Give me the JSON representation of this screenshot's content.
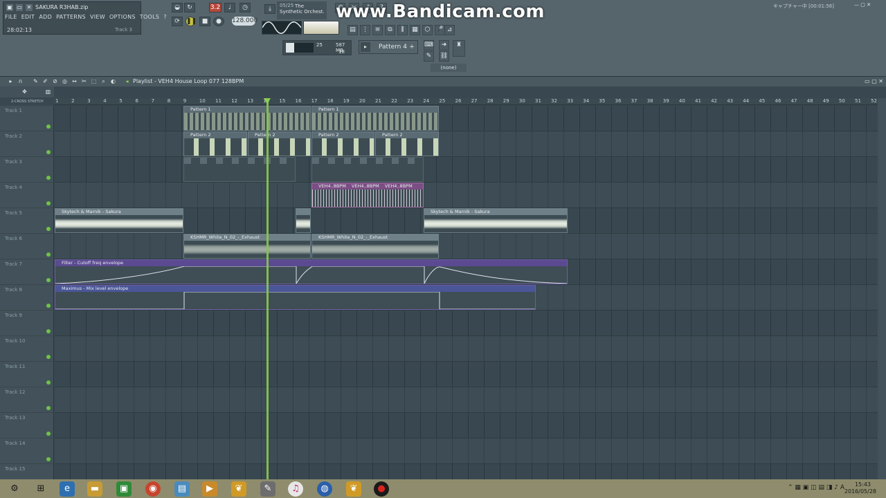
{
  "window": {
    "zip_name": "SAKURA R3HAB.zip",
    "time_readout": "28:02:13",
    "track_hint": "Track 3",
    "menu": [
      "FILE",
      "EDIT",
      "ADD",
      "PATTERNS",
      "VIEW",
      "OPTIONS",
      "TOOLS",
      "?"
    ]
  },
  "transport": {
    "record_label": "3.2",
    "tempo": "128.000"
  },
  "song_info": {
    "counter": "05/25",
    "title_line1": "The",
    "title_line2": "Synthetic Orchest."
  },
  "cpu": {
    "polyphony": "25",
    "memory": "587 MB",
    "voices": "18",
    "cpu_level_fraction": 0.3
  },
  "pattern_selector": {
    "label": "Pattern 4",
    "add": "+"
  },
  "snap": {
    "value": "(none)"
  },
  "watermark": "www.Bandicam.com",
  "capture": {
    "status": "キャプチャー中 [00:01:56]",
    "date": "2016/05/28"
  },
  "playlist": {
    "title": "Playlist - VEH4 House Loop 077 128BPM",
    "snap_labels": "2-CROSS STRETCH",
    "ruler": [
      "1",
      "2",
      "3",
      "4",
      "5",
      "6",
      "7",
      "8",
      "9",
      "10",
      "11",
      "12",
      "13",
      "14",
      "15",
      "16",
      "17",
      "18",
      "19",
      "20",
      "21",
      "22",
      "23",
      "24",
      "25",
      "26",
      "27",
      "28",
      "29",
      "30",
      "31",
      "32",
      "33",
      "34",
      "35",
      "36",
      "37",
      "38",
      "39",
      "40",
      "41",
      "42",
      "43",
      "44",
      "45",
      "46",
      "47",
      "48",
      "49",
      "50",
      "51",
      "52"
    ],
    "tracks": [
      "Track 1",
      "Track 2",
      "Track 3",
      "Track 4",
      "Track 5",
      "Track 6",
      "Track 7",
      "Track 8",
      "Track 9",
      "Track 10",
      "Track 11",
      "Track 12",
      "Track 13",
      "Track 14",
      "Track 15"
    ],
    "clips": {
      "pattern1_a": "Pattern 1",
      "pattern1_b": "Pattern 1",
      "pattern2_a": "Pattern 2",
      "pattern2_b": "Pattern 2",
      "pattern2_c": "Pattern 2",
      "pattern2_d": "Pattern 2",
      "veh_a": "VEH4..8BPM",
      "veh_b": "VEH4..8BPM",
      "veh_c": "VEH4..8BPM",
      "sakura_a": "Skytech & Marnik - Sakura",
      "sakura_c": "Skytech & Marnik - Sakura",
      "kshmr_a": "KSHMR_White_N_02_-_Exhaust",
      "kshmr_b": "KSHMR_White_N_02_-_Exhaust",
      "filter": "Filter - Cutoff freq envelope",
      "maximus": "Maximus - Mix level envelope"
    }
  },
  "taskbar": {
    "time": "15:43",
    "date": "2016/05/28",
    "tray_lang": "A"
  }
}
